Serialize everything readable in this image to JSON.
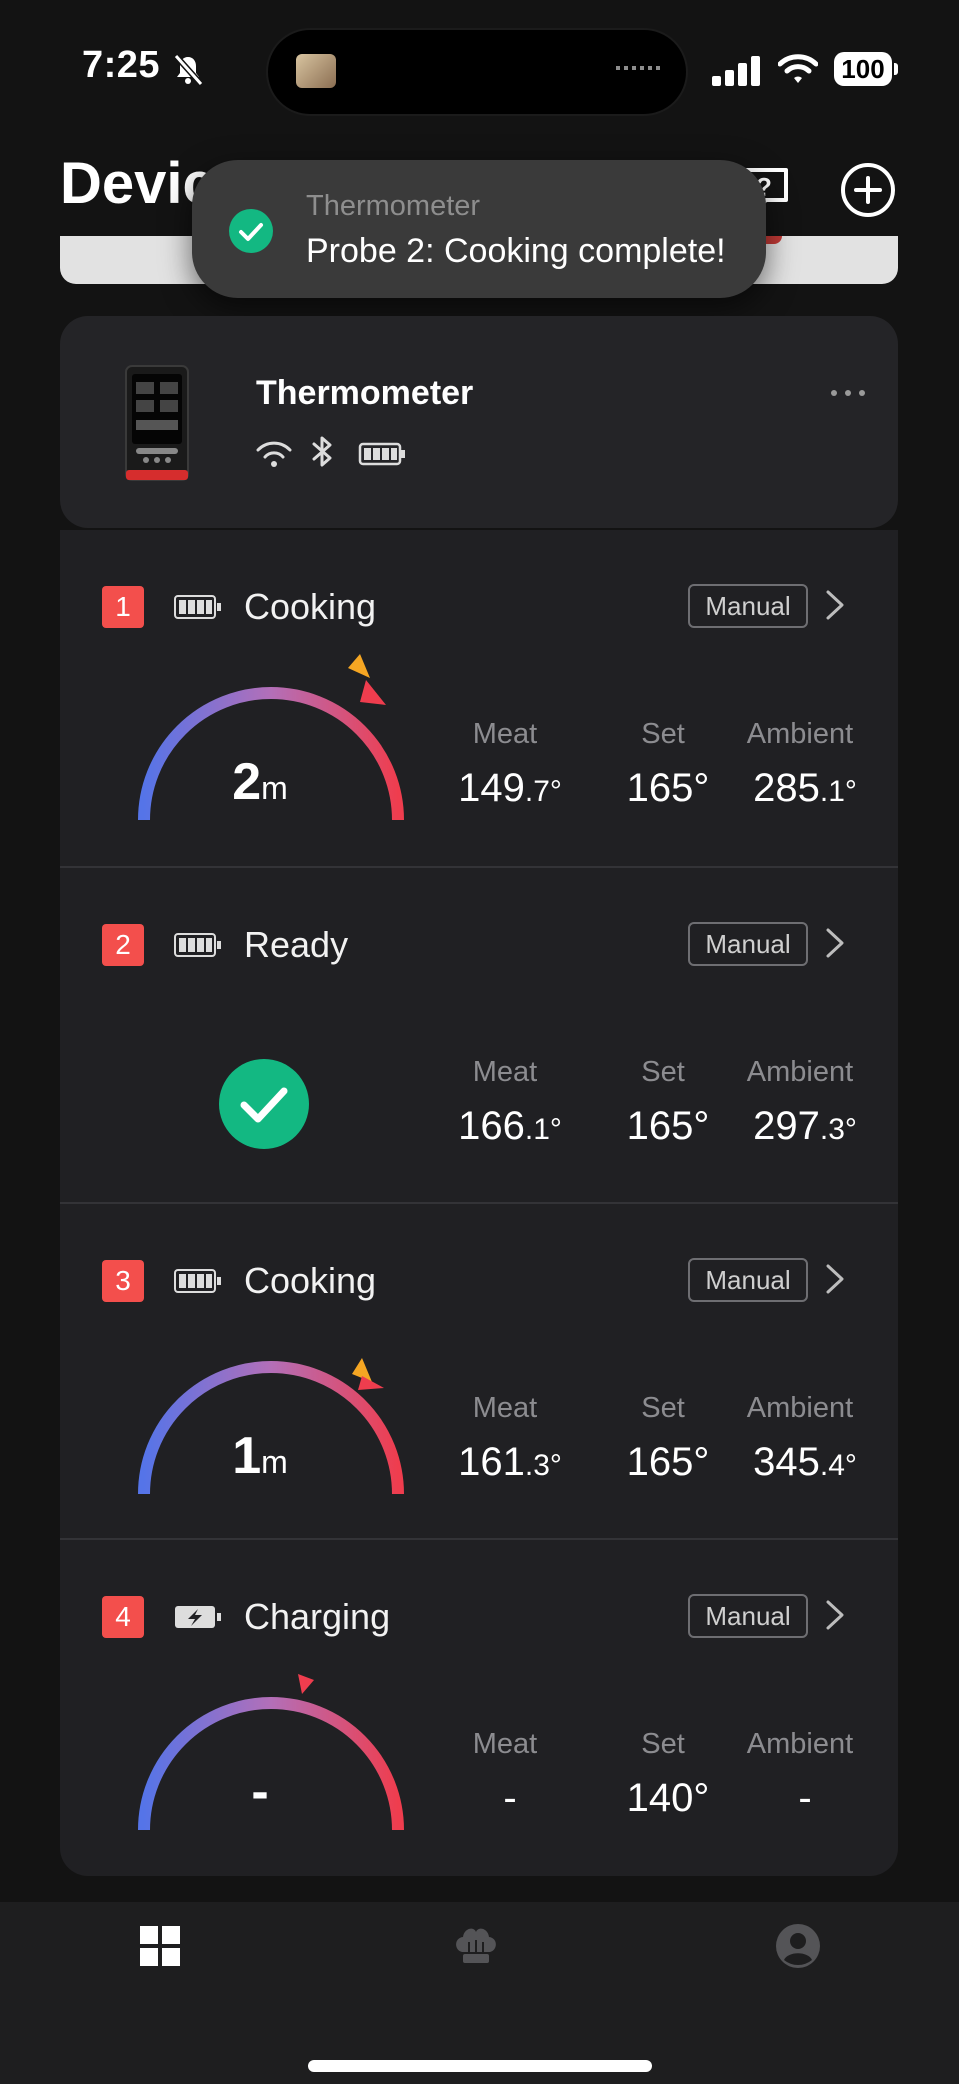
{
  "status_bar": {
    "time": "7:25",
    "battery": "100"
  },
  "header": {
    "title": "Devices"
  },
  "toast": {
    "app": "Thermometer",
    "message": "Probe 2: Cooking complete!"
  },
  "device": {
    "name": "Thermometer",
    "icons": [
      "wifi-icon",
      "bluetooth-icon",
      "battery-icon"
    ]
  },
  "labels": {
    "meat": "Meat",
    "set": "Set",
    "ambient": "Ambient"
  },
  "probes": [
    {
      "number": "1",
      "status": "Cooking",
      "mode": "Manual",
      "battery": "full",
      "time_value": "2",
      "time_unit": "m",
      "meat": "149",
      "meat_dec": ".7°",
      "set": "165°",
      "ambient": "285",
      "ambient_dec": ".1°"
    },
    {
      "number": "2",
      "status": "Ready",
      "mode": "Manual",
      "battery": "full",
      "meat": "166",
      "meat_dec": ".1°",
      "set": "165°",
      "ambient": "297",
      "ambient_dec": ".3°"
    },
    {
      "number": "3",
      "status": "Cooking",
      "mode": "Manual",
      "battery": "full",
      "time_value": "1",
      "time_unit": "m",
      "meat": "161",
      "meat_dec": ".3°",
      "set": "165°",
      "ambient": "345",
      "ambient_dec": ".4°"
    },
    {
      "number": "4",
      "status": "Charging",
      "mode": "Manual",
      "battery": "charging",
      "time_value": "-",
      "time_unit": "",
      "meat": "-",
      "meat_dec": "",
      "set": "140°",
      "ambient": "-",
      "ambient_dec": ""
    }
  ],
  "tabbar": {
    "tabs": [
      "devices-tab",
      "recipes-tab",
      "profile-tab"
    ],
    "active": "devices-tab"
  },
  "colors": {
    "accent_red": "#f34f4c",
    "success_green": "#13b882",
    "gauge_start": "#5574e8",
    "gauge_end": "#ef3d4e",
    "marker_orange": "#f5a623"
  }
}
